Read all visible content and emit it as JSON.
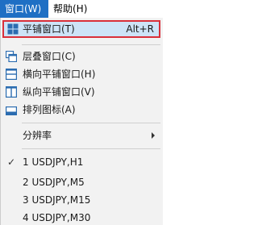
{
  "menubar": {
    "window_label": "窗口(W)",
    "help_label": "帮助(H)"
  },
  "menu": {
    "tile_window": {
      "label": "平铺窗口(T)",
      "shortcut": "Alt+R"
    },
    "cascade": {
      "label": "层叠窗口(C)"
    },
    "tile_horizontal": {
      "label": "横向平铺窗口(H)"
    },
    "tile_vertical": {
      "label": "纵向平铺窗口(V)"
    },
    "arrange_icons": {
      "label": "排列图标(A)"
    },
    "resolution": {
      "label": "分辨率"
    },
    "windows": [
      {
        "label": "1 USDJPY,H1",
        "checked": true
      },
      {
        "label": "2 USDJPY,M5",
        "checked": false
      },
      {
        "label": "3 USDJPY,M15",
        "checked": false
      },
      {
        "label": "4 USDJPY,M30",
        "checked": false
      }
    ],
    "check_glyph": "✓"
  },
  "colors": {
    "menubar_active": "#1e6fc4",
    "highlight_border": "#d9303a",
    "highlight_fill": "#cde3f7",
    "icon_blue": "#2b6cb0"
  }
}
